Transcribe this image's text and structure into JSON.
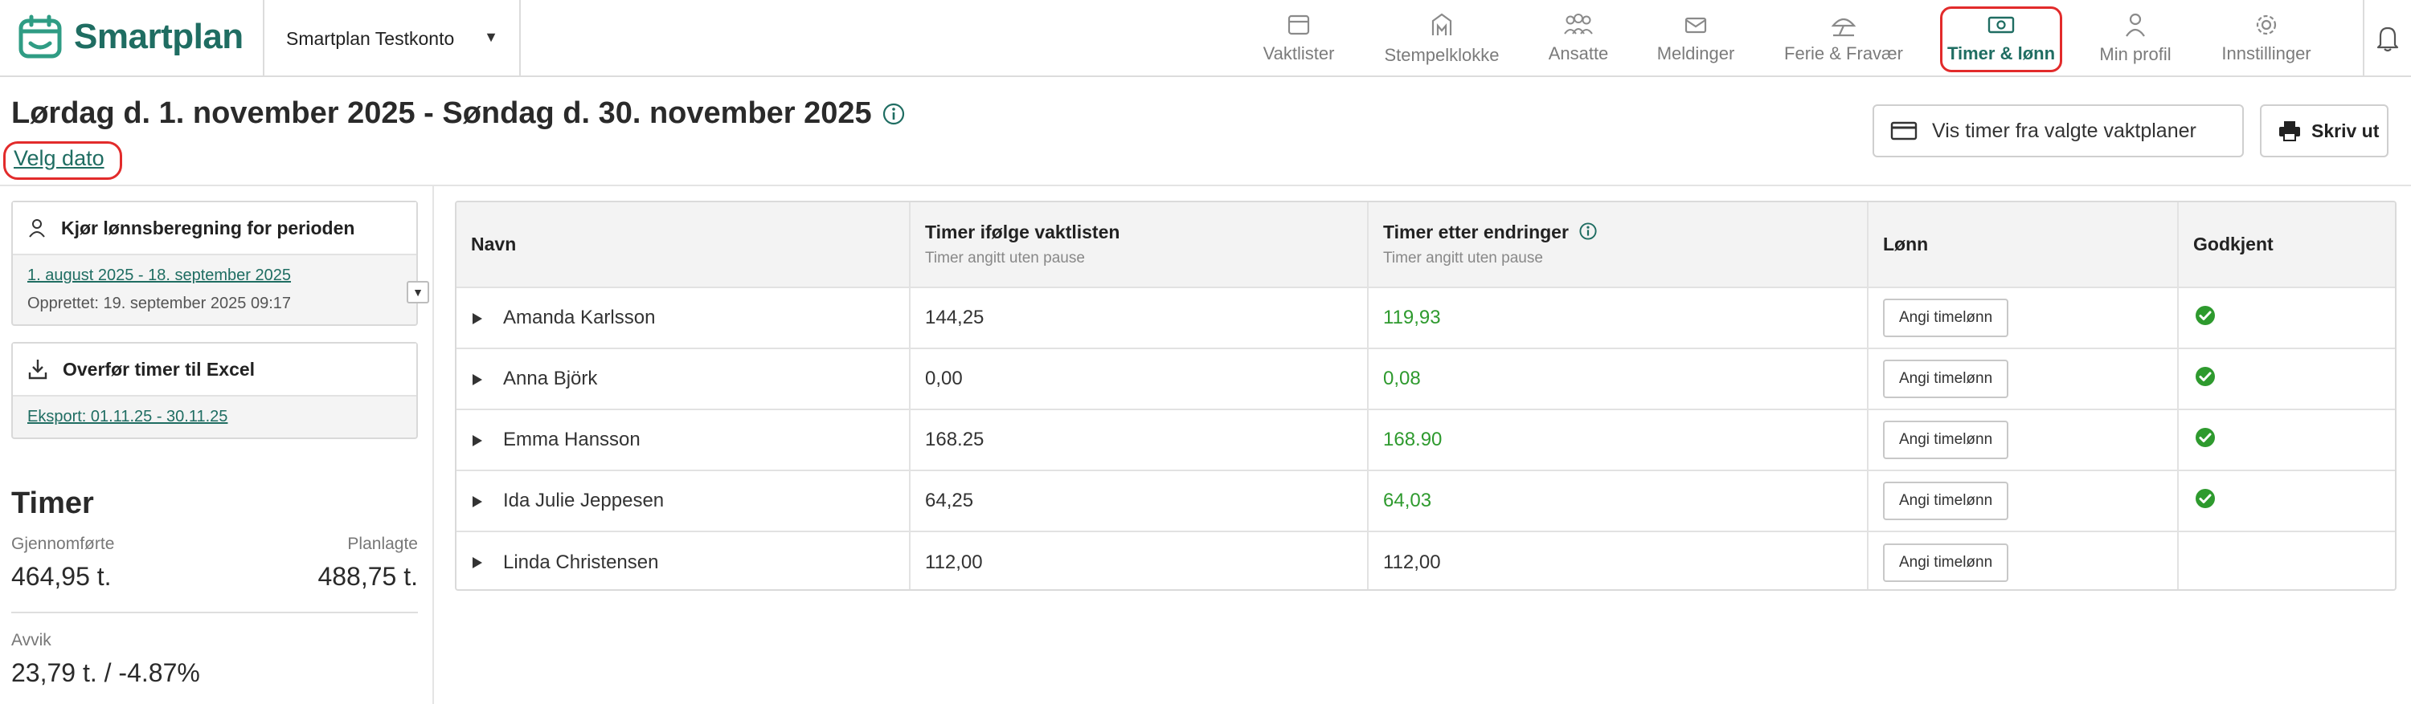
{
  "app": {
    "brand": "Smartplan",
    "account": "Smartplan Testkonto",
    "account_caret": "▼"
  },
  "nav": {
    "items": [
      {
        "label": "Vaktlister",
        "icon": "calendar-icon"
      },
      {
        "label": "Stempelklokke",
        "icon": "stamp-clock-icon"
      },
      {
        "label": "Ansatte",
        "icon": "people-icon"
      },
      {
        "label": "Meldinger",
        "icon": "mail-icon"
      },
      {
        "label": "Ferie & Fravær",
        "icon": "umbrella-icon"
      },
      {
        "label": "Timer & lønn",
        "icon": "money-icon",
        "active": true
      },
      {
        "label": "Min profil",
        "icon": "person-icon"
      },
      {
        "label": "Innstillinger",
        "icon": "gear-icon"
      }
    ],
    "bell_icon": "bell-icon"
  },
  "header": {
    "title": "Lørdag d. 1. november 2025 - Søndag d. 30. november 2025",
    "select_date": "Velg dato",
    "show_hours_button": "Vis timer fra valgte vaktplaner",
    "print_button": "Skriv ut"
  },
  "sidebar": {
    "payroll": {
      "title": "Kjør lønnsberegning for perioden",
      "period_link": "1. august 2025 - 18. september 2025",
      "created": "Opprettet: 19. september 2025 09:17"
    },
    "excel": {
      "title": "Overfør timer til Excel",
      "export_link": "Eksport: 01.11.25 - 30.11.25"
    },
    "timer": {
      "title": "Timer",
      "completed_label": "Gjennomførte",
      "completed_value": "464,95 t.",
      "planned_label": "Planlagte",
      "planned_value": "488,75 t.",
      "deviation_label": "Avvik",
      "deviation_value": "23,79 t. / -4.87%"
    }
  },
  "table": {
    "headers": {
      "name": "Navn",
      "hours_plan": "Timer ifølge vaktlisten",
      "hours_plan_sub": "Timer angitt uten pause",
      "hours_changed": "Timer etter endringer",
      "hours_changed_sub": "Timer angitt uten pause",
      "pay": "Lønn",
      "approved": "Godkjent"
    },
    "rate_button": "Angi timelønn",
    "rows": [
      {
        "name": "Amanda Karlsson",
        "planned": "144,25",
        "changed": "119,93",
        "changed_green": true,
        "approved": true
      },
      {
        "name": "Anna Björk",
        "planned": "0,00",
        "changed": "0,08",
        "changed_green": true,
        "approved": true
      },
      {
        "name": "Emma Hansson",
        "planned": "168.25",
        "changed": "168.90",
        "changed_green": true,
        "approved": true
      },
      {
        "name": "Ida Julie Jeppesen",
        "planned": "64,25",
        "changed": "64,03",
        "changed_green": true,
        "approved": true
      },
      {
        "name": "Linda Christensen",
        "planned": "112,00",
        "changed": "112,00",
        "changed_green": false,
        "approved": false
      }
    ]
  },
  "colors": {
    "brand": "#1f6d62",
    "positive": "#2e9a2e",
    "highlight": "#e22b2b"
  }
}
